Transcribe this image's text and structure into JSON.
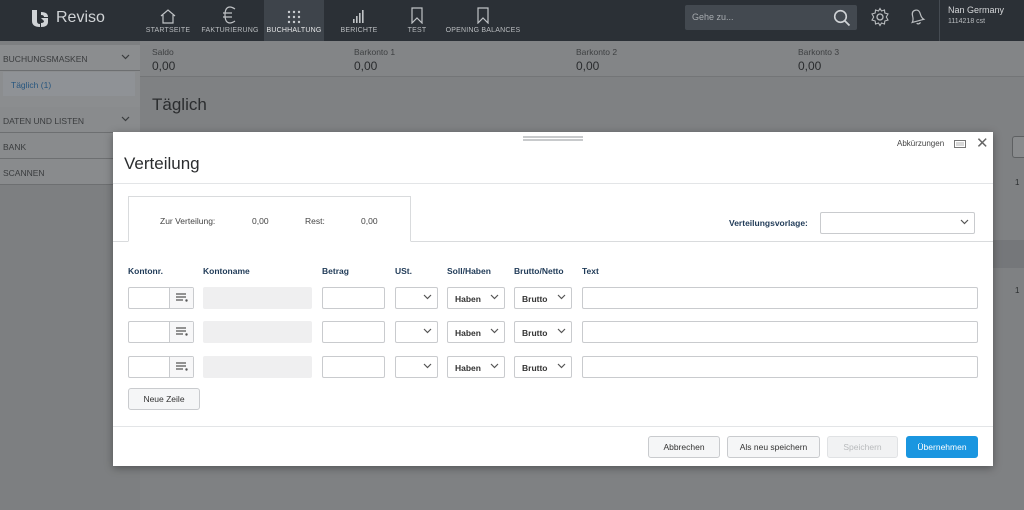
{
  "app": {
    "logo_text": "Reviso"
  },
  "nav": [
    {
      "label": "STARTSEITE",
      "icon": "home-icon"
    },
    {
      "label": "FAKTURIERUNG",
      "icon": "euro-icon"
    },
    {
      "label": "BUCHHALTUNG",
      "icon": "grid-dots-icon",
      "active": true
    },
    {
      "label": "BERICHTE",
      "icon": "bar-chart-icon"
    },
    {
      "label": "TEST",
      "icon": "bookmark-icon"
    },
    {
      "label": "OPENING BALANCES",
      "icon": "bookmark-icon"
    }
  ],
  "search": {
    "placeholder": "Gehe zu..."
  },
  "user": {
    "name": "Nan Germany",
    "id": "1114218 cst"
  },
  "sidebar": {
    "section_main": "BUCHUNGSMASKEN",
    "sub_item": "Täglich (1)",
    "items": [
      "DATEN UND LISTEN",
      "BANK",
      "SCANNEN"
    ]
  },
  "balances": [
    {
      "label": "Saldo",
      "value": "0,00"
    },
    {
      "label": "Barkonto 1",
      "value": "0,00"
    },
    {
      "label": "Barkonto 2",
      "value": "0,00"
    },
    {
      "label": "Barkonto 3",
      "value": "0,00"
    }
  ],
  "page": {
    "title": "Täglich",
    "strip_text_1": "1",
    "strip_text_2": "1"
  },
  "modal": {
    "title": "Verteilung",
    "shortcuts_label": "Abkürzungen",
    "zur_verteilung_label": "Zur Verteilung:",
    "zur_verteilung_value": "0,00",
    "rest_label": "Rest:",
    "rest_value": "0,00",
    "vorlage_label": "Verteilungsvorlage:",
    "vorlage_value": "",
    "columns": {
      "kontonr": "Kontonr.",
      "kontoname": "Kontoname",
      "betrag": "Betrag",
      "ust": "USt.",
      "soll_haben": "Soll/Haben",
      "brutto_netto": "Brutto/Netto",
      "text": "Text"
    },
    "rows": [
      {
        "kontonr": "",
        "kontoname": "",
        "betrag": "",
        "ust": "",
        "soll_haben": "Haben",
        "brutto_netto": "Brutto",
        "text": ""
      },
      {
        "kontonr": "",
        "kontoname": "",
        "betrag": "",
        "ust": "",
        "soll_haben": "Haben",
        "brutto_netto": "Brutto",
        "text": ""
      },
      {
        "kontonr": "",
        "kontoname": "",
        "betrag": "",
        "ust": "",
        "soll_haben": "Haben",
        "brutto_netto": "Brutto",
        "text": ""
      }
    ],
    "new_row_label": "Neue Zeile",
    "buttons": {
      "cancel": "Abbrechen",
      "save_as_new": "Als neu speichern",
      "save": "Speichern",
      "apply": "Übernehmen"
    }
  },
  "colors": {
    "primary": "#1a96e0",
    "topbar": "#2b3036",
    "label_blue": "#1f3a57"
  }
}
